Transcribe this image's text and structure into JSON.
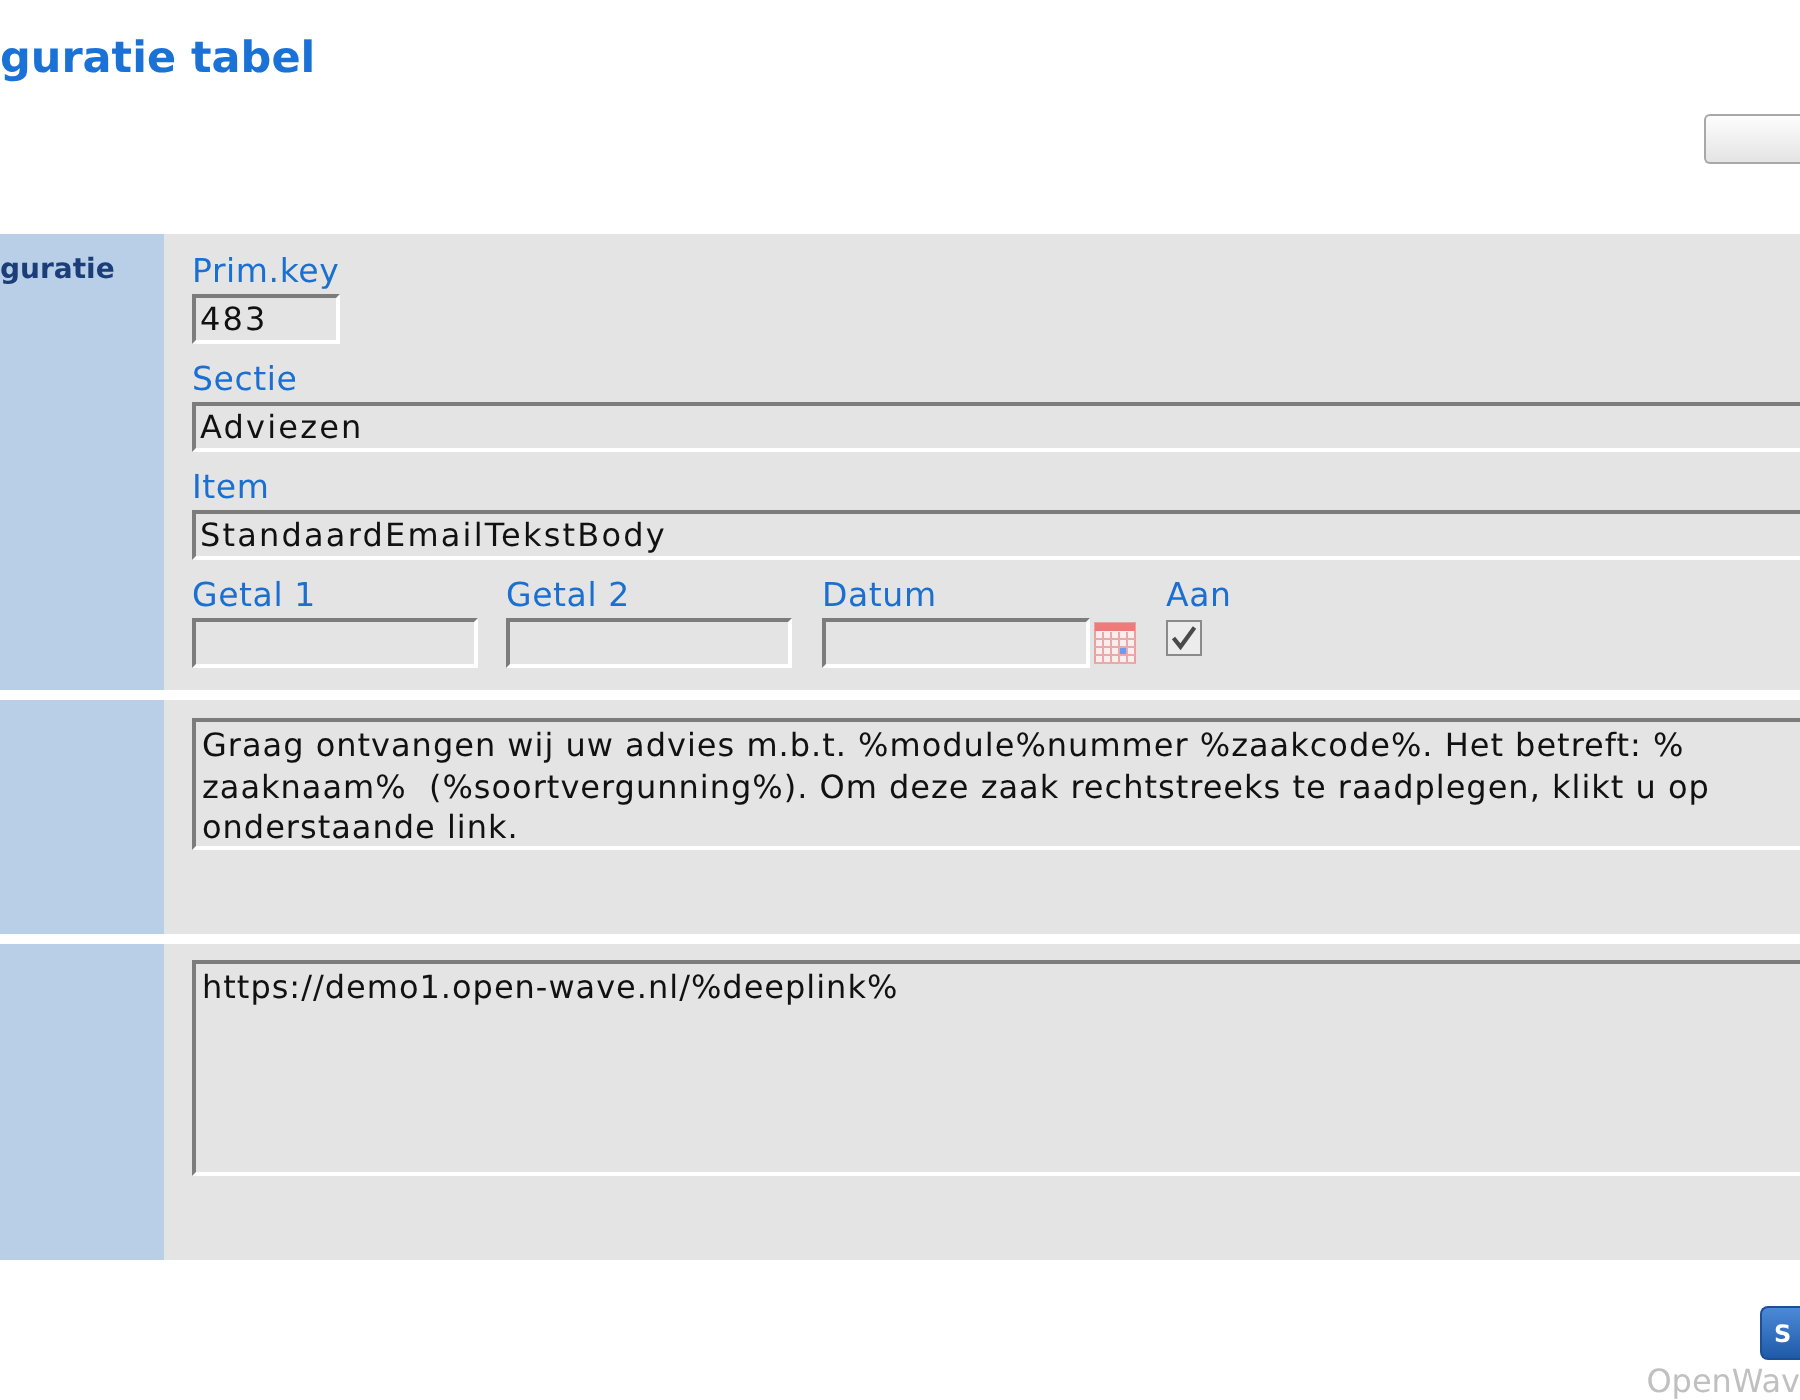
{
  "header": {
    "title": "guratie tabel"
  },
  "form": {
    "sections": [
      {
        "side_label": "guratie",
        "rows": [
          [
            {
              "kind": "key",
              "label": "Prim.key",
              "value": "483"
            }
          ],
          [
            {
              "kind": "text",
              "label": "Sectie",
              "value": "Adviezen"
            }
          ],
          [
            {
              "kind": "text",
              "label": "Item",
              "value": "StandaardEmailTekstBody"
            }
          ],
          [
            {
              "kind": "number",
              "label": "Getal 1"
            },
            {
              "kind": "number",
              "label": "Getal 2"
            },
            {
              "kind": "date",
              "label": "Datum"
            },
            {
              "kind": "checkbox",
              "label": "Aan",
              "checked": true
            }
          ]
        ]
      },
      {
        "rows": [
          [
            {
              "kind": "memo",
              "value": "Graag ontvangen wij uw advies m.b.t. %module%nummer %zaakcode%. Het betreft: %\nzaaknaam%  (%soortvergunning%). Om deze zaak rechtstreeks te raadplegen, klikt u op\nonderstaande link."
            }
          ]
        ]
      },
      {
        "rows": [
          [
            {
              "kind": "memo",
              "value": "https://demo1.open-wave.nl/%deeplink%"
            }
          ]
        ]
      }
    ]
  },
  "actions": {
    "button": "S"
  },
  "footer": {
    "brand": "OpenWav"
  }
}
